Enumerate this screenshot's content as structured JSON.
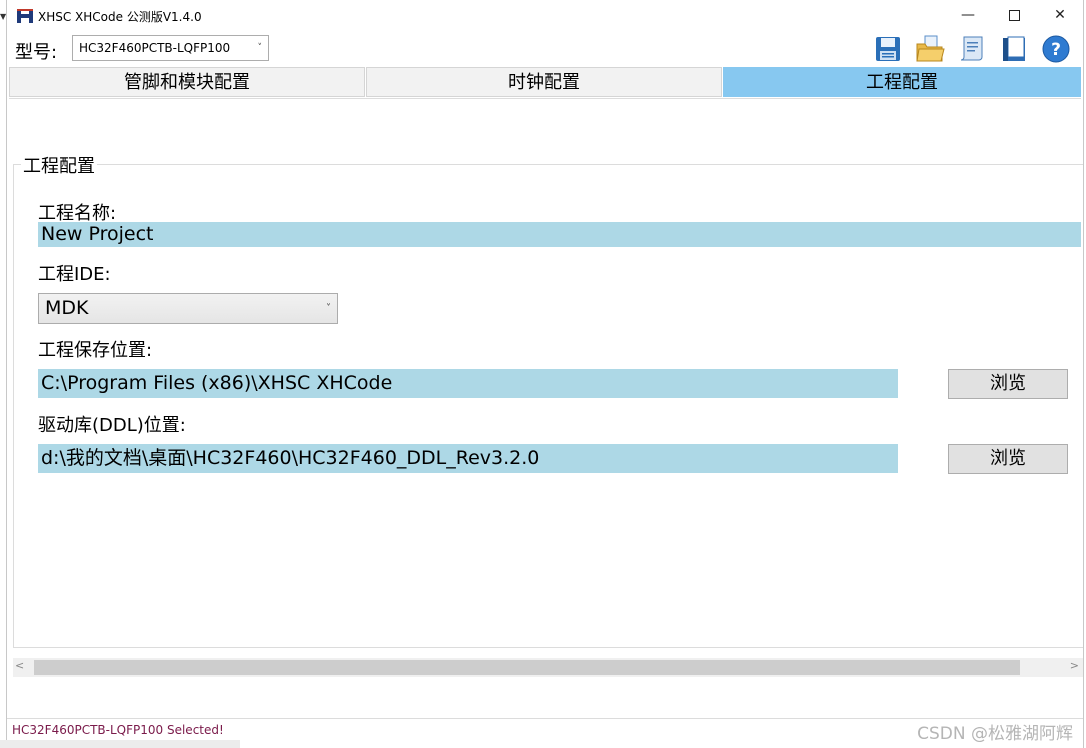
{
  "window": {
    "title": "XHSC XHCode 公测版V1.4.0"
  },
  "model": {
    "label": "型号:",
    "selected": "HC32F460PCTB-LQFP100"
  },
  "toolbar": {
    "icons": [
      "save-icon",
      "open-folder-icon",
      "scroll-icon",
      "book-icon",
      "help-icon"
    ]
  },
  "tabs": [
    {
      "label": "管脚和模块配置",
      "active": false
    },
    {
      "label": "时钟配置",
      "active": false
    },
    {
      "label": "工程配置",
      "active": true
    }
  ],
  "project": {
    "group_title": "工程配置",
    "name_label": "工程名称:",
    "name_value": "New Project",
    "ide_label": "工程IDE:",
    "ide_value": "MDK",
    "save_label": "工程保存位置:",
    "save_value": "C:\\Program Files (x86)\\XHSC XHCode",
    "ddl_label": "驱动库(DDL)位置:",
    "ddl_value": "d:\\我的文档\\桌面\\HC32F460\\HC32F460_DDL_Rev3.2.0",
    "browse_label": "浏览"
  },
  "status": {
    "text": "HC32F460PCTB-LQFP100 Selected!"
  },
  "watermark": "CSDN @松雅湖阿辉",
  "colors": {
    "active_tab": "#87c8f0",
    "field_bg": "#add8e6",
    "status_text": "#7a1a4a"
  }
}
